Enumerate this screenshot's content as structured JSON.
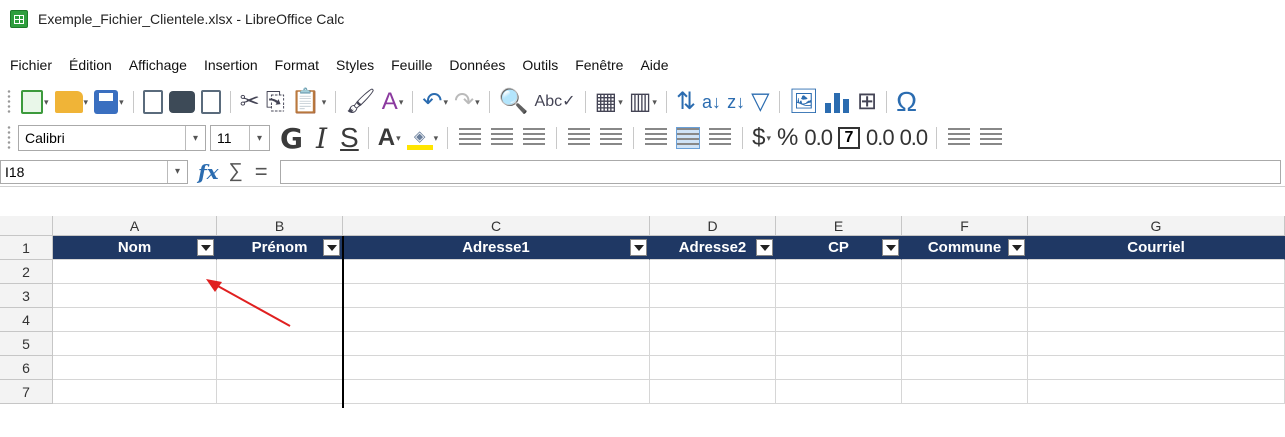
{
  "window": {
    "title": "Exemple_Fichier_Clientele.xlsx - LibreOffice Calc"
  },
  "menu": [
    "Fichier",
    "Édition",
    "Affichage",
    "Insertion",
    "Format",
    "Styles",
    "Feuille",
    "Données",
    "Outils",
    "Fenêtre",
    "Aide"
  ],
  "format_toolbar": {
    "font_name": "Calibri",
    "font_size": "11",
    "bold_label": "G",
    "italic_label": "I",
    "underline_label": "S",
    "font_color_label": "A",
    "currency_label": "$",
    "percent_label": "%",
    "number_label": "0.0",
    "decimal_add_label": "0.0",
    "decimal_remove_label": "0.0"
  },
  "formula_bar": {
    "cell_ref": "I18",
    "fx_label": "fx",
    "sigma_label": "∑",
    "equal_label": "=",
    "value": ""
  },
  "columns": [
    "A",
    "B",
    "C",
    "D",
    "E",
    "F",
    "G"
  ],
  "rows": [
    "1",
    "2",
    "3",
    "4",
    "5",
    "6",
    "7"
  ],
  "table_headers": [
    "Nom",
    "Prénom",
    "Adresse1",
    "Adresse2",
    "CP",
    "Commune",
    "Courriel"
  ],
  "colors": {
    "header_bg": "#1f3864",
    "header_text": "#ffffff",
    "arrow": "#e02020"
  }
}
